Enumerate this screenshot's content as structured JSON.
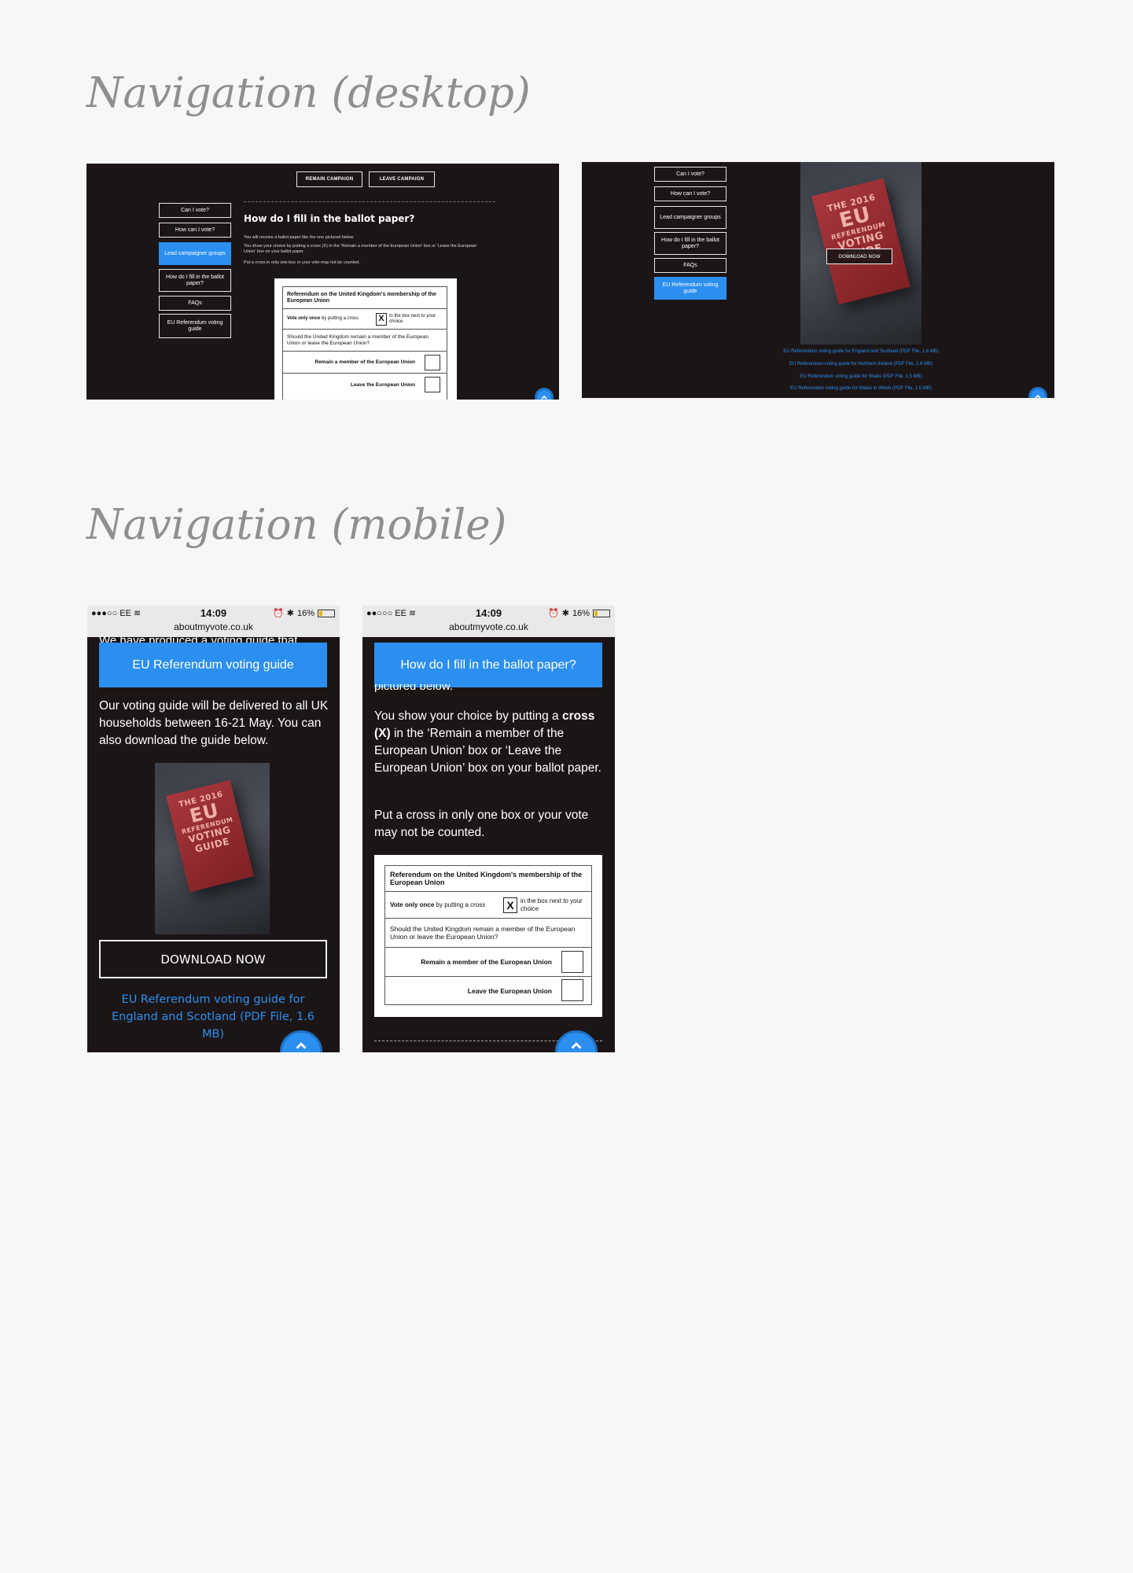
{
  "headings": {
    "desktop": "Navigation (desktop)",
    "mobile": "Navigation (mobile)"
  },
  "desktop1": {
    "campaign_buttons": [
      "REMAIN CAMPAIGN",
      "LEAVE CAMPAIGN"
    ],
    "nav": [
      "Can I vote?",
      "How can I vote?",
      "Lead campaigner groups",
      "How do I fill in the ballot paper?",
      "FAQs",
      "EU Referendum voting guide"
    ],
    "active_nav_index": 2,
    "title": "How do I fill in the ballot paper?",
    "p1": "You will receive a ballot paper like the one pictured below.",
    "p2": "You show your choice by putting a cross (X) in the 'Remain a member of the European Union' box or 'Leave the European Union' box on your ballot paper.",
    "p3": "Put a cross in only one box or your vote may not be counted."
  },
  "ballot": {
    "title": "Referendum on the United Kingdom's membership of the European Union",
    "vote_only_once": "Vote only once",
    "by_putting": "by putting a cross",
    "x_mark": "X",
    "box_next": "in the box next to your choice",
    "question": "Should the United Kingdom remain a member of the European Union or leave the European Union?",
    "remain": "Remain a member of the European Union",
    "leave": "Leave the European Union"
  },
  "desktop2": {
    "nav": [
      "Can I vote?",
      "How can I vote?",
      "Lead campaigner groups",
      "How do I fill in the ballot paper?",
      "FAQs",
      "EU Referendum voting guide"
    ],
    "active_nav_index": 5,
    "download": "DOWNLOAD NOW",
    "links": [
      "EU Referendum voting guide for England and Scotland (PDF File, 1.6 MB)",
      "EU Referendum voting guide for Northern Ireland (PDF File, 1.6 MB)",
      "EU Referendum voting guide for Wales (PDF File, 1.5 MB)",
      "EU Referendum voting guide for Wales in Welsh (PDF File, 1.0 MB)"
    ]
  },
  "book_cover": [
    "THE 2016",
    "EU",
    "REFERENDUM",
    "VOTING",
    "GUIDE"
  ],
  "status_bar": {
    "carrier": "EE",
    "time": "14:09",
    "battery": "16%",
    "url": "aboutmyvote.co.uk"
  },
  "mobile1": {
    "clipped_text": "We have produced a voting guide that",
    "header": "EU Referendum voting guide",
    "body": "Our voting guide will be delivered to all UK households between 16-21 May. You can also download the guide below.",
    "download": "DOWNLOAD NOW",
    "link": "EU Referendum voting guide for England and Scotland (PDF File, 1.6 MB)"
  },
  "mobile2": {
    "clipped_text": "pictured below.",
    "header": "How do I fill in the ballot paper?",
    "p1_pre": "You show your choice by putting a ",
    "p1_bold": "cross (X)",
    "p1_post": " in the ‘Remain a member of the European Union’ box or ‘Leave the European Union’ box on your ballot paper.",
    "p2": "Put a cross in only one box or your vote may not be counted."
  },
  "colors": {
    "accent": "#2b8ff0",
    "panel_bg": "#1c1516",
    "page_bg": "#f7f7f7",
    "heading": "#8f8f8f"
  }
}
